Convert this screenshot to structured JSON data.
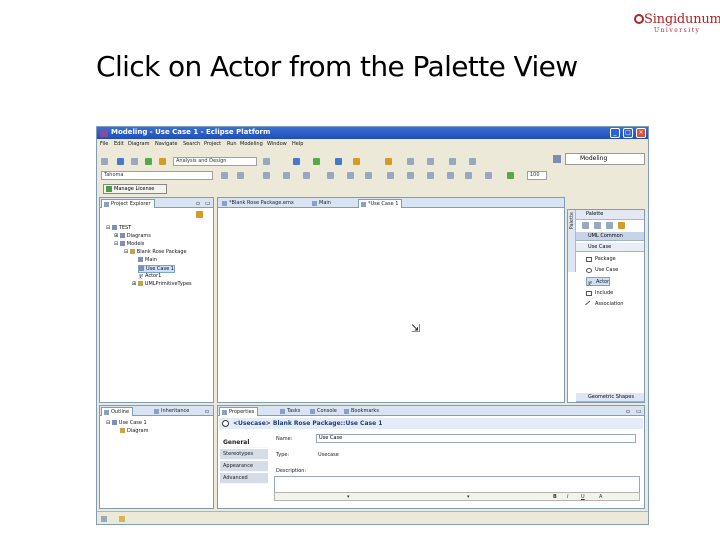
{
  "slide": {
    "title": "Click on Actor from the Palette View",
    "logo": {
      "name": "Singidunum",
      "subtitle": "University"
    }
  },
  "window": {
    "title": "Modeling - Use Case 1 - Eclipse Platform",
    "controls": {
      "minimize": "_",
      "maximize": "□",
      "close": "×"
    }
  },
  "menu": [
    "File",
    "Edit",
    "Diagram",
    "Navigate",
    "Search",
    "Project",
    "Run",
    "Modeling",
    "Window",
    "Help"
  ],
  "toolbar": {
    "analysis_combo": "Analysis and Design",
    "font_combo": "Tahoma",
    "zoom_value": "100",
    "manage_button": "Manage License",
    "perspective": "Modeling"
  },
  "explorer": {
    "tab": "Project Explorer",
    "tree": [
      {
        "label": "TEST"
      },
      {
        "label": "Diagrams"
      },
      {
        "label": "Models"
      },
      {
        "label": "Blank Rose Package"
      },
      {
        "label": "Main"
      },
      {
        "label": "Use Case 1"
      },
      {
        "label": "Actor1"
      },
      {
        "label": "UMLPrimitiveTypes"
      }
    ]
  },
  "editor": {
    "tabs": [
      "*Blank Rose Package.emx",
      "Main",
      "*Use Case 1"
    ]
  },
  "palette": {
    "title": "Palette",
    "vertical_tab": "Palette",
    "drawers": [
      "UML Common",
      "Use Case"
    ],
    "items": [
      "Package",
      "Use Case",
      "Actor",
      "Include",
      "Association"
    ],
    "footer": "Geometric Shapes"
  },
  "outline": {
    "tabs": [
      "Outline",
      "Inheritance"
    ],
    "tree": [
      {
        "label": "Use Case 1"
      },
      {
        "label": "Diagram"
      }
    ]
  },
  "properties": {
    "tabs": [
      "Properties",
      "Tasks",
      "Console",
      "Bookmarks"
    ],
    "header": "<Usecase> Blank Rose Package::Use Case 1",
    "categories": [
      "General",
      "Stereotypes",
      "Appearance",
      "Advanced"
    ],
    "fields": {
      "name_label": "Name:",
      "name_value": "Use Case",
      "type_label": "Type:",
      "type_value": "Usecase",
      "description_label": "Description:"
    },
    "format": [
      "B",
      "I",
      "U",
      "A"
    ]
  }
}
